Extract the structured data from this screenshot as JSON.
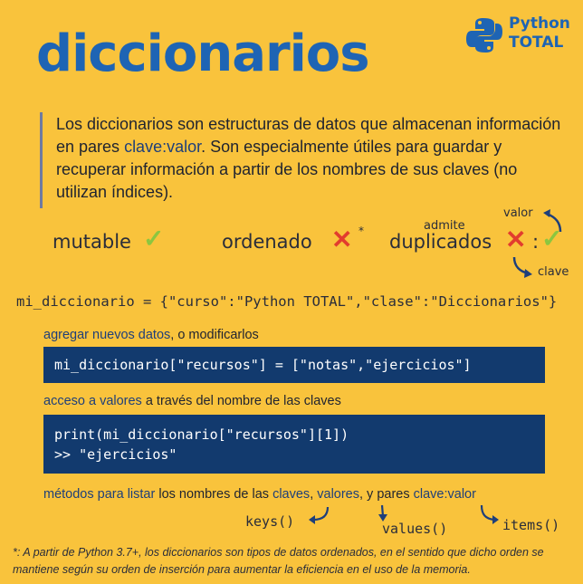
{
  "title": "diccionarios",
  "logo": {
    "line1": "Python",
    "line2": "TOTAL",
    "icon": "python-logo-icon"
  },
  "intro": {
    "part1": "Los diccionarios son estructuras de datos que almacenan información en pares ",
    "highlight": "clave:valor",
    "part2": ". Son especialmente útiles para guardar y recuperar información a partir de los nombres de sus claves (no utilizan índices)."
  },
  "properties": {
    "mutable": "mutable",
    "ordenado": "ordenado",
    "asterisk": "*",
    "duplicados": "duplicados",
    "admite": "admite",
    "colon": ":",
    "valor": "valor",
    "clave": "clave",
    "check_symbol": "✓",
    "cross_symbol": "✕"
  },
  "code_example": "mi_diccionario = {\"curso\":\"Python TOTAL\",\"clase\":\"Diccionarios\"}",
  "sections": {
    "add": {
      "highlight": "agregar nuevos datos",
      "rest": ", o modificarlos"
    },
    "add_code": "mi_diccionario[\"recursos\"] = [\"notas\",\"ejercicios\"]",
    "access": {
      "highlight": "acceso a valores",
      "rest": " a través del nombre de las claves"
    },
    "access_code_1": "print(mi_diccionario[\"recursos\"][1])",
    "access_code_2": ">> \"ejercicios\"",
    "methods": {
      "h1": "métodos para listar",
      "t1": " los nombres de las ",
      "h2": "claves",
      "t2": ", ",
      "h3": "valores",
      "t3": ", y pares ",
      "h4": "clave:valor"
    }
  },
  "methods_list": {
    "keys": "keys()",
    "values": "values()",
    "items": "items()"
  },
  "footnote": "*: A partir de Python 3.7+, los diccionarios son tipos de datos ordenados, en el sentido que dicho orden se mantiene según su orden de inserción para aumentar la eficiencia en el uso de la memoria.",
  "colors": {
    "background": "#f9c33c",
    "brand_blue": "#1e64b4",
    "code_bg": "#123a6e",
    "check": "#8cc63f",
    "cross": "#e23c2e"
  }
}
